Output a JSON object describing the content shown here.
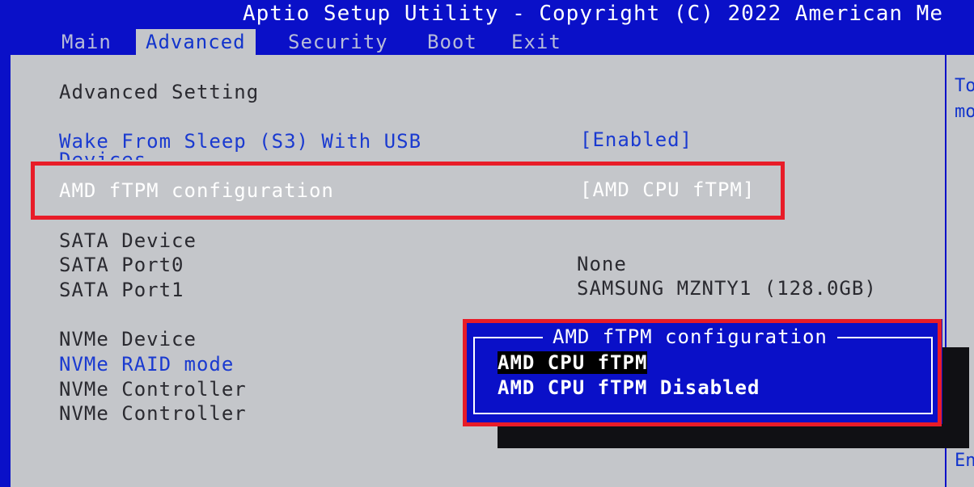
{
  "header": {
    "title": "Aptio Setup Utility - Copyright (C) 2022 American Me"
  },
  "tabs": [
    {
      "label": "Main"
    },
    {
      "label": "Advanced"
    },
    {
      "label": "Security"
    },
    {
      "label": "Boot"
    },
    {
      "label": "Exit"
    }
  ],
  "active_tab": "Advanced",
  "main": {
    "section_title": "Advanced Setting",
    "items": [
      {
        "label": "Wake From Sleep (S3) With USB",
        "label2": "Devices",
        "value": "[Enabled]"
      },
      {
        "label": "AMD fTPM configuration",
        "value": "[AMD CPU fTPM]"
      },
      {
        "label": "SATA Device"
      },
      {
        "label": "SATA Port0",
        "value": "None"
      },
      {
        "label": "SATA Port1",
        "value": "SAMSUNG MZNTY1 (128.0GB)"
      },
      {
        "label": "NVMe Device"
      },
      {
        "label": "NVMe RAID mode"
      },
      {
        "label": "NVMe Controller"
      },
      {
        "label": "NVMe Controller"
      }
    ]
  },
  "help": {
    "line1": "To",
    "line2": "mo",
    "line3": "En"
  },
  "popup": {
    "title": "AMD fTPM configuration",
    "options": [
      "AMD CPU fTPM",
      "AMD CPU fTPM Disabled"
    ],
    "selected_index": 0
  },
  "colors": {
    "bios_blue": "#0a10c8",
    "panel_gray": "#c4c6ca",
    "link_blue": "#1a3ad0",
    "highlight_red": "#e81c28"
  }
}
